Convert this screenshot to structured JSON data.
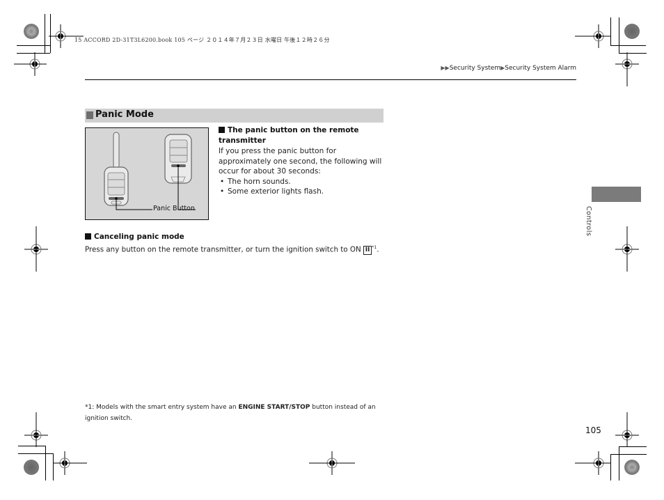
{
  "print_header": "15 ACCORD 2D-31T3L6200.book  105 ページ  ２０１４年７月２３日  水曜日  午後１２時２６分",
  "breadcrumb": {
    "items": [
      "Security System",
      "Security System Alarm"
    ],
    "separator_icon": "right-triangle-icon"
  },
  "section": {
    "title": "Panic Mode"
  },
  "figure": {
    "callout_label": "Panic Button"
  },
  "panic_button_info": {
    "heading": "The panic button on the remote transmitter",
    "body": "If you press the panic button for approximately one second, the following will occur for about 30 seconds:",
    "bullets": [
      "The horn sounds.",
      "Some exterior lights flash."
    ]
  },
  "canceling": {
    "heading": "Canceling panic mode",
    "body": "Press any button on the remote transmitter, or turn the ignition switch to ON",
    "switch_position": "II",
    "footnote_ref": "*1",
    "end": "."
  },
  "footnote": {
    "marker": "*1:",
    "text_before": "Models with the smart entry system have an",
    "bold_text": "ENGINE START/STOP",
    "text_after": "button instead of an ignition switch."
  },
  "side_tab": {
    "label": "Controls"
  },
  "page_number": "105",
  "colors": {
    "section_bar": "#d0d0d0",
    "section_square": "#6e6e6e",
    "side_tab": "#7b7b7b",
    "figure_bg": "#d6d6d6"
  }
}
